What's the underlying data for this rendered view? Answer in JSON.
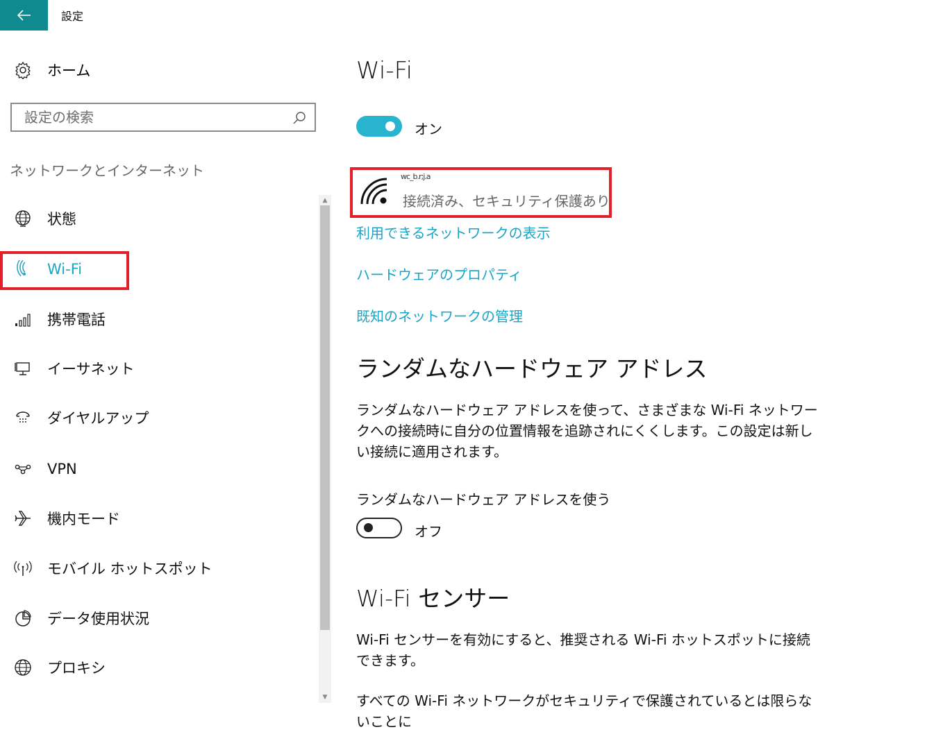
{
  "window": {
    "title": "設定"
  },
  "nav": {
    "home_label": "ホーム",
    "search_placeholder": "設定の検索",
    "group_title": "ネットワークとインターネット",
    "items": [
      {
        "label": "状態",
        "icon": "globe-icon"
      },
      {
        "label": "Wi-Fi",
        "icon": "wifi-icon",
        "selected": true
      },
      {
        "label": "携帯電話",
        "icon": "signal-bars-icon"
      },
      {
        "label": "イーサネット",
        "icon": "ethernet-icon"
      },
      {
        "label": "ダイヤルアップ",
        "icon": "dialup-icon"
      },
      {
        "label": "VPN",
        "icon": "vpn-icon"
      },
      {
        "label": "機内モード",
        "icon": "airplane-icon"
      },
      {
        "label": "モバイル ホットスポット",
        "icon": "hotspot-icon"
      },
      {
        "label": "データ使用状況",
        "icon": "pie-chart-icon"
      },
      {
        "label": "プロキシ",
        "icon": "globe-icon"
      }
    ]
  },
  "main": {
    "title": "Wi-Fi",
    "wifi_toggle": {
      "state": "オン",
      "on": true
    },
    "network": {
      "name": "wc_b.r;j.a",
      "status": "接続済み、セキュリティ保護あり"
    },
    "links": [
      "利用できるネットワークの表示",
      "ハードウェアのプロパティ",
      "既知のネットワークの管理"
    ],
    "random_mac": {
      "heading": "ランダムなハードウェア アドレス",
      "description": "ランダムなハードウェア アドレスを使って、さまざまな Wi-Fi ネットワークへの接続時に自分の位置情報を追跡されにくくします。この設定は新しい接続に適用されます。",
      "toggle_label": "ランダムなハードウェア アドレスを使う",
      "toggle_state": "オフ",
      "on": false
    },
    "sense": {
      "heading": "Wi-Fi センサー",
      "description": "Wi-Fi センサーを有効にすると、推奨される Wi-Fi ホットスポットに接続できます。",
      "description2": "すべての Wi-Fi ネットワークがセキュリティで保護されているとは限らないことに"
    }
  },
  "colors": {
    "accent": "#1aa4c6",
    "titlebar": "#0f8a8e",
    "highlight": "#e3202a",
    "toggle_on": "#28b3cf"
  }
}
